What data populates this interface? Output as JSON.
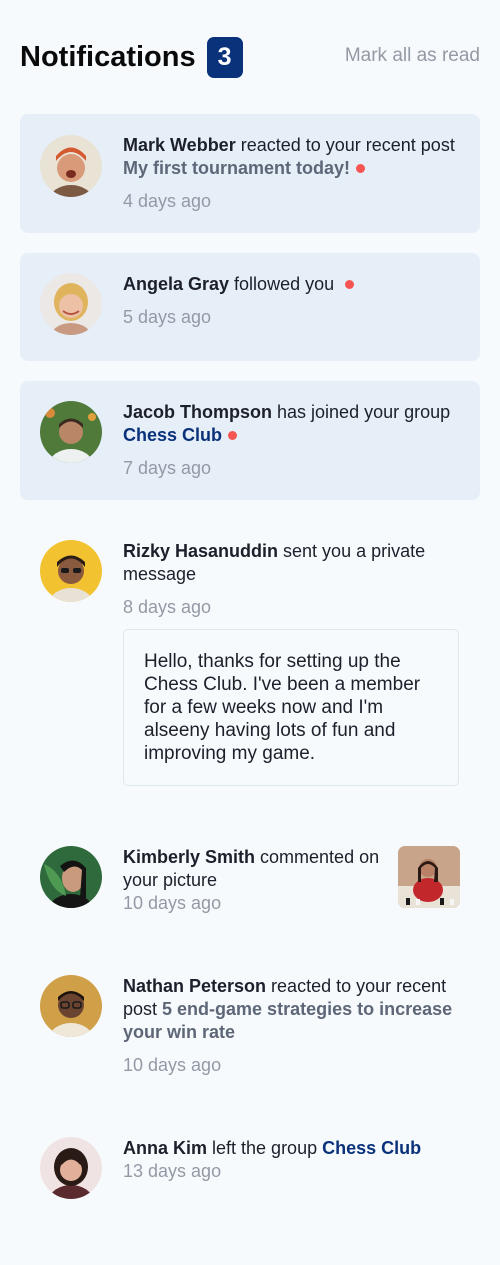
{
  "header": {
    "title": "Notifications",
    "unread_count": "3",
    "mark_all_label": "Mark all as read"
  },
  "notifications": [
    {
      "user": "Mark Webber",
      "action": " reacted to your recent post ",
      "target": "My first tournament today!",
      "time": "4 days ago",
      "unread": true
    },
    {
      "user": "Angela Gray",
      "action": " followed you ",
      "time": "5 days ago",
      "unread": true
    },
    {
      "user": "Jacob Thompson",
      "action": " has joined your group ",
      "target": "Chess Club",
      "time": "7 days ago",
      "unread": true
    },
    {
      "user": "Rizky Hasanuddin",
      "action": " sent you a private message",
      "time": "8 days ago",
      "message": "Hello, thanks for setting up the Chess Club. I've been a member for a few weeks now and I'm alseeny having lots of fun and improving my game.",
      "unread": false
    },
    {
      "user": "Kimberly Smith",
      "action": " commented on your picture",
      "time": "10 days ago",
      "unread": false
    },
    {
      "user": "Nathan Peterson",
      "action": " reacted to your recent post ",
      "target": "5 end-game strategies to increase your win rate",
      "time": "10 days ago",
      "unread": false
    },
    {
      "user": "Anna Kim",
      "action": " left the group ",
      "target": "Chess Club",
      "time": "13 days ago",
      "unread": false
    }
  ],
  "colors": {
    "unread_background": "#e6eef8",
    "badge_background": "#0a327b",
    "unread_dot": "#f65552",
    "group_link": "#0a327b",
    "post_link": "#5e6778",
    "muted_text": "#939aa5"
  }
}
